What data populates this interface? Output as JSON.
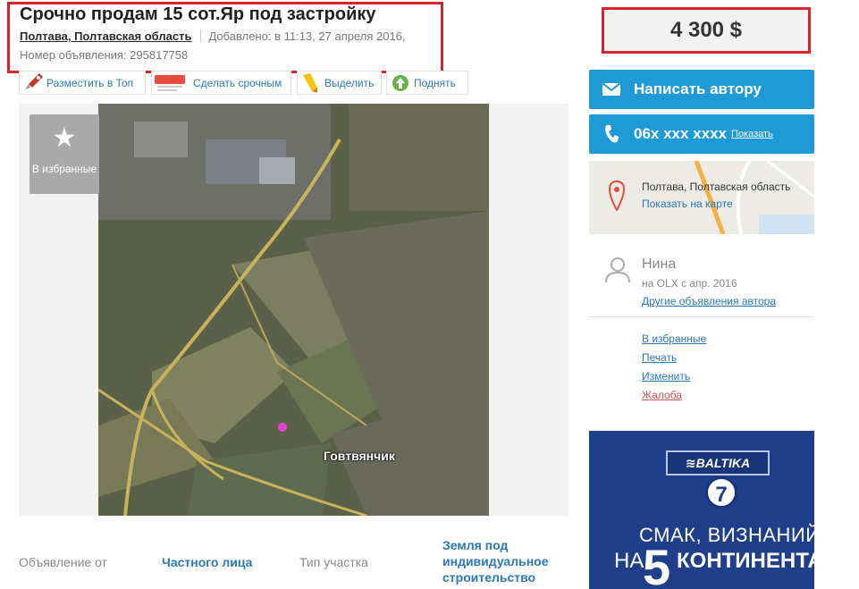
{
  "listing": {
    "title": "Срочно продам 15 сот.Яр под застройку",
    "location": "Полтава, Полтавская область",
    "added": "Добавлено: в 11:13, 27 апреля 2016,",
    "ad_number": "Номер объявления: 295817758"
  },
  "promo": [
    {
      "label": "Разместить в Топ",
      "icon": "rocket-icon"
    },
    {
      "label": "Сделать срочным",
      "icon": "urgent-tag-icon"
    },
    {
      "label": "Выделить",
      "icon": "highlighter-icon"
    },
    {
      "label": "Поднять",
      "icon": "arrow-up-icon"
    }
  ],
  "gallery": {
    "favorite_label": "В избранные",
    "photo_caption": "Говтвянчик"
  },
  "params": {
    "offer_from_label": "Объявление от",
    "offer_from_value": "Частного лица",
    "plot_type_label": "Тип участка",
    "plot_type_value": "Земля под индивидуальное строительство",
    "plot_type_lines": [
      "Земля под",
      "индивидуальное",
      "строительство"
    ]
  },
  "sidebar": {
    "price": "4 300 $",
    "write_button": "Написать автору",
    "phone": "06x xxx xxxx",
    "phone_show": "Показать",
    "map_location": "Полтава, Полтавская область",
    "map_link": "Показать на карте"
  },
  "user": {
    "name": "Нина",
    "since": "на OLX с апр. 2016",
    "other_ads": "Другие объявления автора"
  },
  "actions": [
    "В избранные",
    "Печать",
    "Изменить",
    "Жалоба"
  ],
  "ad_banner": {
    "brand": "≋BALTIKA",
    "number": "7",
    "line1": "СМАК, ВИЗНАНИЙ",
    "line2_prefix": "НА",
    "line2_big": "5",
    "line2_suffix": "КОНТИНЕНТАХ"
  },
  "colors": {
    "accent": "#1e9bd7",
    "highlight_border": "#d9232e",
    "link": "#2a77b9"
  }
}
